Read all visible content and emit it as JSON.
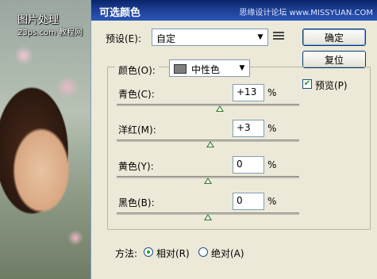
{
  "background": {
    "watermark_line1": "图片处理",
    "watermark_line2": "23ps.com",
    "watermark_line3": "教程网"
  },
  "dialog": {
    "title": "可选颜色",
    "site_text": "思缘设计论坛 www.MISSYUAN.COM",
    "preset": {
      "label": "预设(E):",
      "value": "自定"
    },
    "buttons": {
      "ok": "确定",
      "reset": "复位"
    },
    "preview": {
      "label": "预览(P)",
      "checked": true
    },
    "colors": {
      "label": "颜色(O):",
      "value": "中性色",
      "swatch_color": "#7f7f7f"
    },
    "sliders": [
      {
        "label": "青色(C):",
        "value": "+13",
        "unit": "%",
        "level": 0.565
      },
      {
        "label": "洋红(M):",
        "value": "+3",
        "unit": "%",
        "level": 0.515
      },
      {
        "label": "黄色(Y):",
        "value": "0",
        "unit": "%",
        "level": 0.5
      },
      {
        "label": "黑色(B):",
        "value": "0",
        "unit": "%",
        "level": 0.5
      }
    ],
    "method": {
      "label": "方法:",
      "options": [
        "相对(R)",
        "绝对(A)"
      ],
      "selected": "相对(R)"
    }
  }
}
